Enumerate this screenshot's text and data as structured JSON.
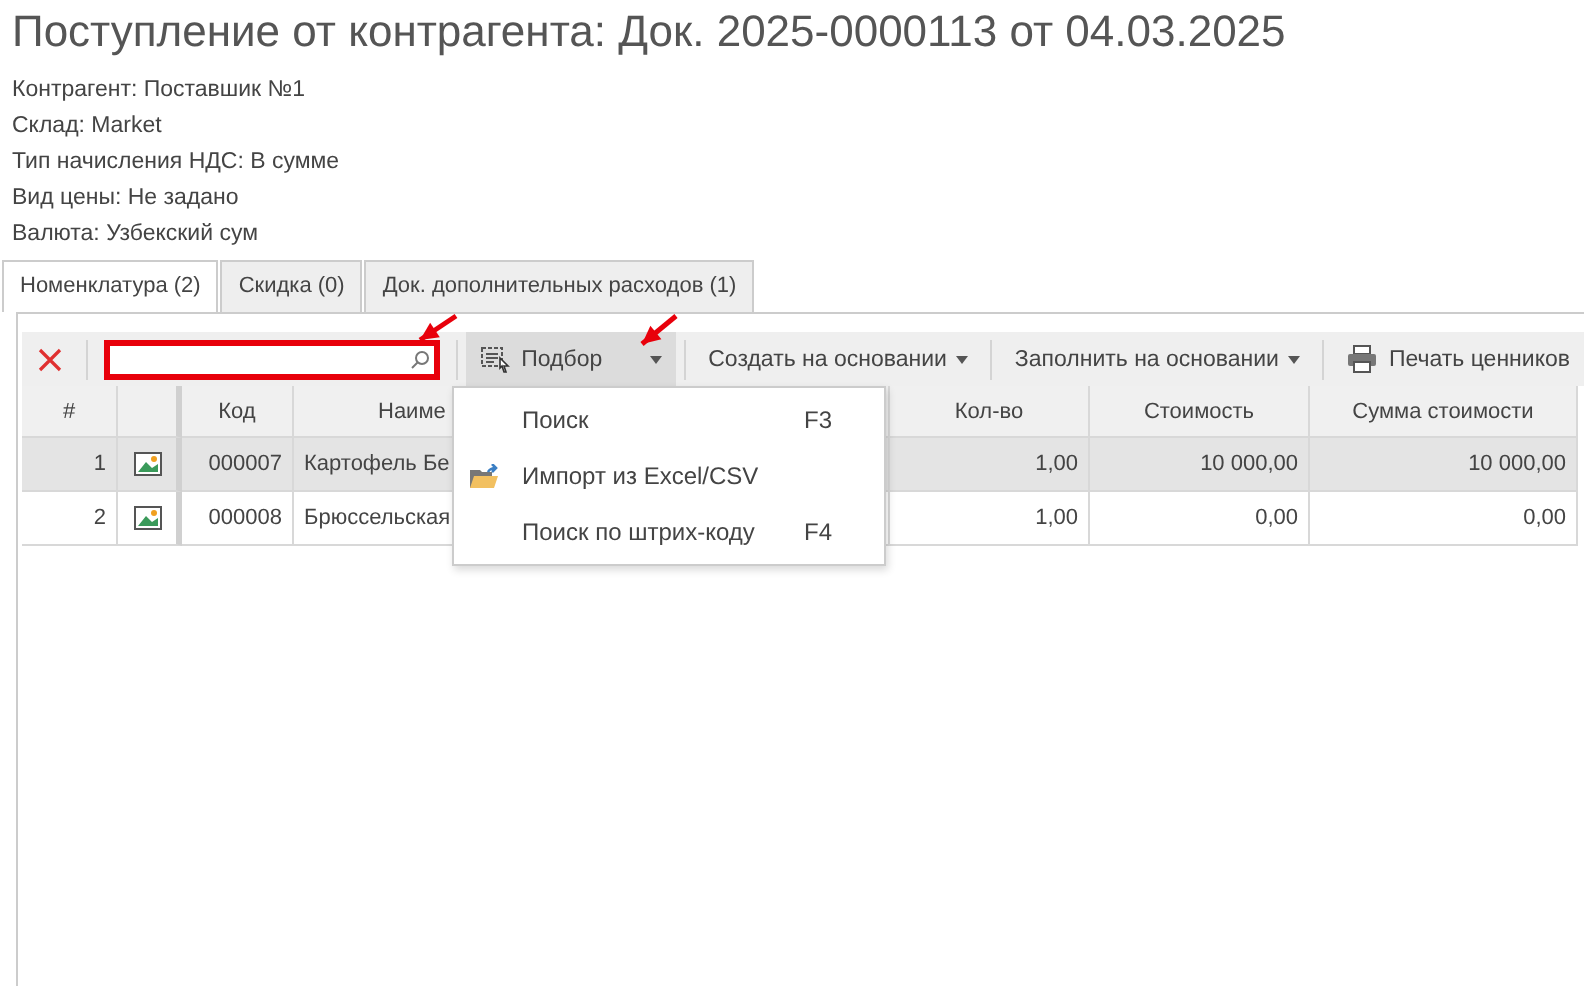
{
  "title": "Поступление от контрагента: Док. 2025-0000113 от 04.03.2025",
  "info": [
    "Контрагент: Поставшик №1",
    "Склад: Market",
    "Тип начисления НДС: В сумме",
    "Вид цены: Не задано",
    "Валюта: Узбекский сум"
  ],
  "tabs": [
    {
      "label": "Номенклатура (2)",
      "selected": true
    },
    {
      "label": "Скидка (0)",
      "selected": false
    },
    {
      "label": "Док. дополнительных расходов (1)",
      "selected": false
    }
  ],
  "toolbar": {
    "search": {
      "highlighted": true
    },
    "buttons": [
      {
        "kind": "split",
        "label": "Подбор",
        "pressed": true
      },
      {
        "kind": "dropdown",
        "label": "Создать на основании",
        "pressed": false
      },
      {
        "kind": "dropdown",
        "label": "Заполнить на основании",
        "pressed": false
      },
      {
        "kind": "print",
        "label": "Печать ценников",
        "pressed": false
      }
    ]
  },
  "table": {
    "columns": [
      "#",
      "",
      "Код",
      "Наиме",
      "Кол-во",
      "Стоимость",
      "Сумма стоимости"
    ],
    "rows": [
      {
        "selected": true,
        "cells": [
          "1",
          "",
          "000007",
          "Картофель Бе",
          "1,00",
          "10 000,00",
          "10 000,00"
        ]
      },
      {
        "selected": false,
        "cells": [
          "2",
          "",
          "000008",
          "Брюссельская",
          "1,00",
          "0,00",
          "0,00"
        ]
      }
    ]
  },
  "menu": [
    {
      "kind": "plain",
      "label": "Поиск",
      "shortcut": "F3"
    },
    {
      "kind": "import",
      "label": "Импорт из Excel/CSV"
    },
    {
      "kind": "plain",
      "label": "Поиск по штрих-коду",
      "shortcut": "F4"
    }
  ],
  "callout_arrows": [
    {
      "kind": "arrow"
    },
    {
      "kind": "arrow"
    }
  ]
}
